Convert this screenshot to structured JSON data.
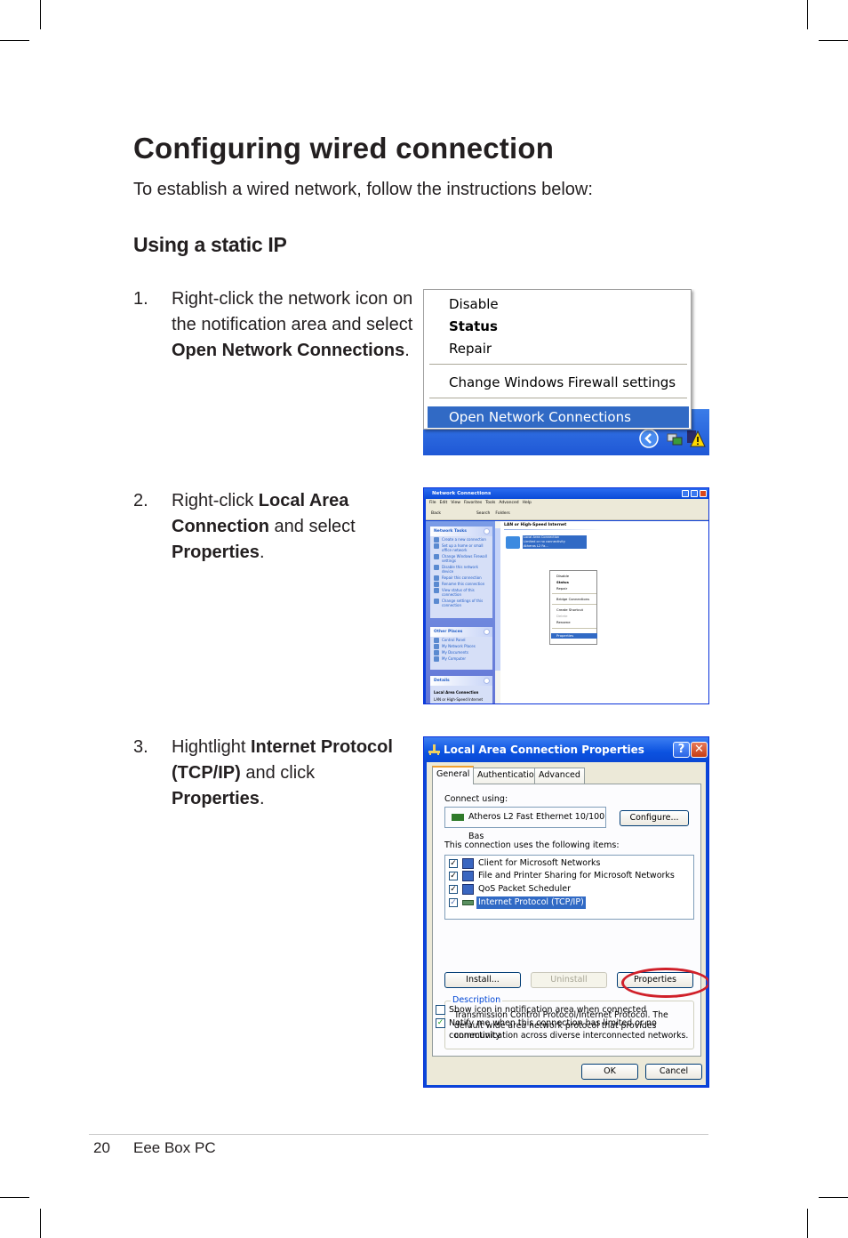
{
  "page": {
    "title": "Configuring wired connection",
    "intro": "To establish a wired network, follow the instructions below:",
    "subheading": "Using a static IP",
    "steps": [
      {
        "number": "1.",
        "text_a": "Right-click the network icon on the notification area and select ",
        "bold_a": "Open Network Connections",
        "text_b": "."
      },
      {
        "number": "2.",
        "text_a": "Right-click ",
        "bold_a": "Local Area Connection",
        "text_b": " and select ",
        "bold_b": "Properties",
        "text_c": "."
      },
      {
        "number": "3.",
        "text_a": "Hightlight ",
        "bold_a": "Internet Protocol (TCP/IP)",
        "text_b": " and click ",
        "bold_b": "Properties",
        "text_c": "."
      }
    ],
    "footer": {
      "page_number": "20",
      "product": "Eee Box PC"
    }
  },
  "screenshot1": {
    "menu_items": [
      {
        "label": "Disable"
      },
      {
        "label": "Status"
      },
      {
        "label": "Repair"
      },
      {
        "label": "Change Windows Firewall settings"
      },
      {
        "label": "Open Network Connections"
      }
    ],
    "tray_icons": [
      "show-hidden-icons",
      "network-icon",
      "warning-icon"
    ]
  },
  "screenshot2": {
    "window_title": "Network Connections",
    "menu": [
      "File",
      "Edit",
      "View",
      "Favorites",
      "Tools",
      "Advanced",
      "Help"
    ],
    "toolbar": [
      "Back",
      "Search",
      "Folders"
    ],
    "network_tasks": {
      "title": "Network Tasks",
      "items": [
        "Create a new connection",
        "Set up a home or small office network",
        "Change Windows Firewall settings",
        "Disable this network device",
        "Repair this connection",
        "Rename this connection",
        "View status of this connection",
        "Change settings of this connection"
      ]
    },
    "other_places": {
      "title": "Other Places",
      "items": [
        "Control Panel",
        "My Network Places",
        "My Documents",
        "My Computer"
      ]
    },
    "details": {
      "title": "Details",
      "name": "Local Area Connection",
      "type": "LAN or High-Speed Internet"
    },
    "group_header": "LAN or High-Speed Internet",
    "connection_label": [
      "Local Area Connection",
      "Limited or no connectivity",
      "Atheros L2 Fa..."
    ],
    "context_menu": [
      "Disable",
      "Status",
      "Repair",
      "Bridge Connections",
      "Create Shortcut",
      "Delete",
      "Rename",
      "Properties"
    ]
  },
  "screenshot3": {
    "window_title": "Local Area Connection Properties",
    "help": "?",
    "close": "✕",
    "tabs": [
      "General",
      "Authentication",
      "Advanced"
    ],
    "connect_using_label": "Connect using:",
    "adapter": "Atheros L2 Fast Ethernet 10/100 Bas",
    "configure_button": "Configure...",
    "items_label": "This connection uses the following items:",
    "items": [
      {
        "label": "Client for Microsoft Networks",
        "checked": true
      },
      {
        "label": "File and Printer Sharing for Microsoft Networks",
        "checked": true
      },
      {
        "label": "QoS Packet Scheduler",
        "checked": true
      },
      {
        "label": "Internet Protocol (TCP/IP)",
        "checked": true,
        "selected": true
      }
    ],
    "install_button": "Install...",
    "uninstall_button": "Uninstall",
    "properties_button": "Properties",
    "description_legend": "Description",
    "description": "Transmission Control Protocol/Internet Protocol. The default wide area network protocol that provides communication across diverse interconnected networks.",
    "show_icon_option": {
      "label": "Show icon in notification area when connected",
      "checked": false
    },
    "notify_option": {
      "label": "Notify me when this connection has limited or no connectivity",
      "checked": true
    },
    "ok_button": "OK",
    "cancel_button": "Cancel",
    "highlight_color": "#d0202a"
  }
}
